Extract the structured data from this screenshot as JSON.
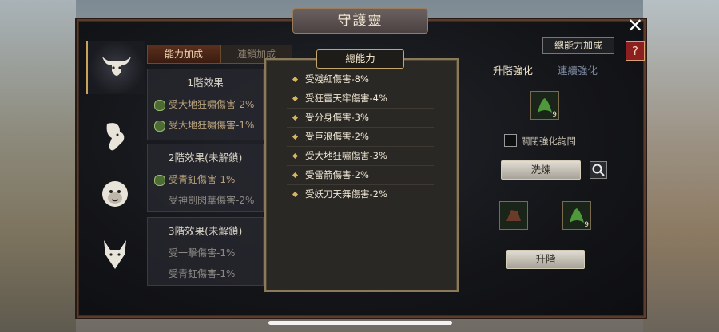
{
  "window": {
    "title": "守護靈",
    "close_symbol": "✕",
    "help_symbol": "?"
  },
  "sidebar": {
    "items": [
      {
        "name": "ox-icon",
        "active": true
      },
      {
        "name": "goat-icon",
        "active": false
      },
      {
        "name": "monkey-icon",
        "active": false
      },
      {
        "name": "wolf-icon",
        "active": false
      }
    ]
  },
  "tabs": {
    "ability_bonus": "能力加成",
    "chain_bonus": "連鎖加成"
  },
  "tiers": [
    {
      "title": "1階效果",
      "lines": [
        {
          "text": "受大地狂嘯傷害-2%",
          "unlocked": true
        },
        {
          "text": "受大地狂嘯傷害-1%",
          "unlocked": true
        }
      ]
    },
    {
      "title": "2階效果(未解鎖)",
      "lines": [
        {
          "text": "受青釭傷害-1%",
          "unlocked": true
        },
        {
          "text": "受神劍閃華傷害-2%",
          "unlocked": false
        }
      ]
    },
    {
      "title": "3階效果(未解鎖)",
      "lines": [
        {
          "text": "受一擊傷害-1%",
          "unlocked": false
        },
        {
          "text": "受青釭傷害-1%",
          "unlocked": false
        }
      ]
    }
  ],
  "popup": {
    "title": "總能力",
    "rows": [
      "受殘紅傷害-8%",
      "受狂雷天牢傷害-4%",
      "受分身傷害-3%",
      "受巨浪傷害-2%",
      "受大地狂嘯傷害-3%",
      "受雷箭傷害-2%",
      "受妖刀天舞傷害-2%"
    ]
  },
  "right_panel": {
    "total_button": "總能力加成",
    "tab_upgrade": "升階強化",
    "tab_chain": "連續強化",
    "item_top_count": "9",
    "checkbox_label": "關閉強化詢問",
    "refine_button": "洗煉",
    "item_bottom_count": "9",
    "upgrade_button": "升階"
  },
  "colors": {
    "accent_gold": "#c9a35a",
    "frame_brown": "#5a3b2c",
    "help_red": "#8c1f1f"
  }
}
